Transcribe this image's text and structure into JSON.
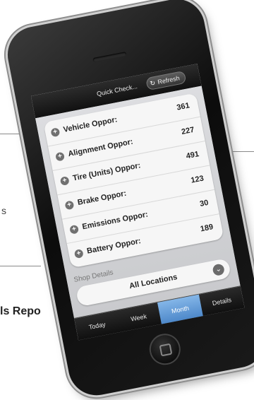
{
  "background": {
    "fragment_s": "s",
    "heading_fragment": "ls Repo"
  },
  "app": {
    "title": "Quick Check...",
    "refresh_label": "Refresh",
    "refresh_icon": "↻"
  },
  "list": [
    {
      "label": "Vehicle Oppor:",
      "value": "361"
    },
    {
      "label": "Alignment Oppor:",
      "value": "227"
    },
    {
      "label": "Tire (Units) Oppor:",
      "value": "491"
    },
    {
      "label": "Brake Oppor:",
      "value": "123"
    },
    {
      "label": "Emissions Oppor:",
      "value": "30"
    },
    {
      "label": "Battery Oppor:",
      "value": "189"
    }
  ],
  "shop_details": {
    "label": "Shop Details",
    "selected": "All Locations"
  },
  "tabs": [
    "Today",
    "Week",
    "Month",
    "Details"
  ],
  "active_tab": "Month",
  "colors": {
    "accent": "#5b95d4",
    "header": "#1a1a1a",
    "phone": "#111111"
  }
}
